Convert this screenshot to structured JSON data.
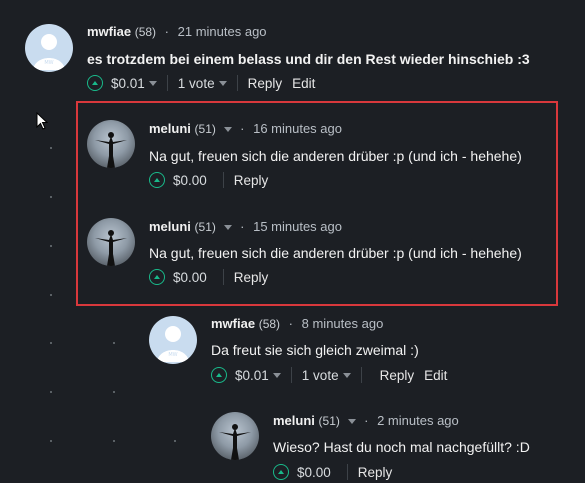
{
  "comments": [
    {
      "author": "mwfiae",
      "rep": "(58)",
      "time": "21 minutes ago",
      "text": "es trotzdem bei einem belass und dir den Rest wieder hinschieb :3",
      "payout": "$0.01",
      "votes": "1 vote",
      "reply": "Reply",
      "edit": "Edit"
    },
    {
      "author": "meluni",
      "rep": "(51)",
      "time": "16 minutes ago",
      "text": "Na gut, freuen sich die anderen drüber :p (und ich - hehehe)",
      "payout": "$0.00",
      "reply": "Reply"
    },
    {
      "author": "meluni",
      "rep": "(51)",
      "time": "15 minutes ago",
      "text": "Na gut, freuen sich die anderen drüber :p (und ich - hehehe)",
      "payout": "$0.00",
      "reply": "Reply"
    },
    {
      "author": "mwfiae",
      "rep": "(58)",
      "time": "8 minutes ago",
      "text": "Da freut sie sich gleich zweimal :)",
      "payout": "$0.01",
      "votes": "1 vote",
      "reply": "Reply",
      "edit": "Edit"
    },
    {
      "author": "meluni",
      "rep": "(51)",
      "time": "2 minutes ago",
      "text": "Wieso? Hast du noch mal nachgefüllt? :D",
      "payout": "$0.00",
      "reply": "Reply"
    }
  ],
  "colors": {
    "background": "#1c1f24",
    "upvote_accent": "#19b98a",
    "highlight_border": "#d9383c"
  },
  "icons": {
    "upvote": "upvote-circle-icon",
    "caret": "chevron-down-icon",
    "cursor": "mouse-pointer-icon",
    "default_avatar": "default-user-avatar-icon"
  }
}
